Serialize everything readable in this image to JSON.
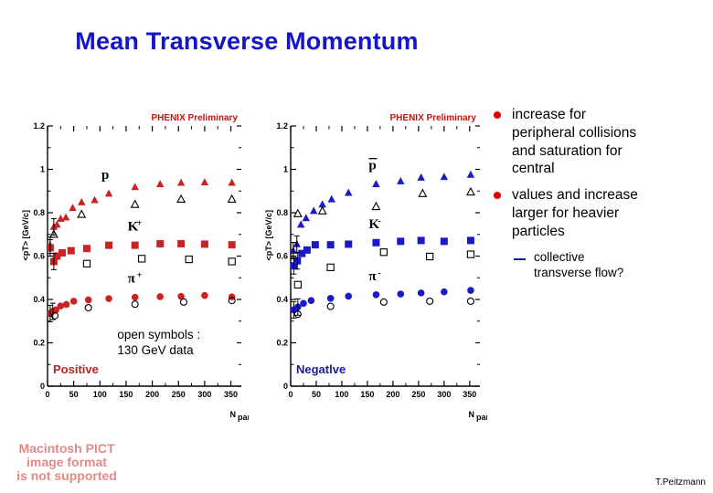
{
  "slide": {
    "title": "Mean Transverse Momentum",
    "footer": "T.Peitzmann"
  },
  "pict_placeholder": {
    "line1": "Macintosh PICT",
    "line2": "image format",
    "line3": "is not supported",
    "color": "#e08a8a"
  },
  "bullets": [
    {
      "text": "increase for peripheral collisions and saturation for central",
      "marker_color": "#e00000"
    },
    {
      "text": "values and increase larger for heavier particles",
      "marker_color": "#e00000"
    }
  ],
  "sub_bullets": [
    {
      "text": "collective transverse flow?",
      "marker_color": "#1a1aa0"
    }
  ],
  "chart_data": [
    {
      "id": "positive",
      "type": "scatter",
      "title": "",
      "preliminary_tag": "PHENIX Preliminary",
      "preliminary_color": "#cc1111",
      "charge_label": "Positive",
      "charge_label_color": "#b32424",
      "annotation_lines": [
        "open symbols :",
        "130 GeV data"
      ],
      "color": "#cc2222",
      "xlabel": "N",
      "xlabel_sub": "part",
      "ylabel": "<p",
      "ylabel_sub": "T",
      "ylabel_unit": "> [GeV/c]",
      "xlim": [
        0,
        370
      ],
      "ylim": [
        0,
        1.2
      ],
      "xticks": [
        0,
        50,
        100,
        150,
        200,
        250,
        300,
        350
      ],
      "yticks": [
        0,
        0.2,
        0.4,
        0.6,
        0.8,
        1,
        1.2
      ],
      "grid": false,
      "series": [
        {
          "name": "p",
          "label": "p",
          "label_sup": "",
          "marker": "triangle",
          "filled": true,
          "x": [
            5,
            12,
            18,
            25,
            35,
            48,
            65,
            90,
            117,
            167,
            215,
            255,
            300,
            352
          ],
          "y": [
            0.65,
            0.735,
            0.745,
            0.772,
            0.778,
            0.822,
            0.848,
            0.858,
            0.888,
            0.918,
            0.932,
            0.938,
            0.94,
            0.938
          ]
        },
        {
          "name": "p-130",
          "label": "",
          "marker": "triangle",
          "filled": false,
          "x": [
            12,
            65,
            167,
            255,
            352
          ],
          "y": [
            0.7,
            0.792,
            0.838,
            0.862,
            0.862
          ]
        },
        {
          "name": "K+",
          "label": "K",
          "label_sup": "+",
          "marker": "square",
          "filled": true,
          "x": [
            5,
            12,
            18,
            28,
            45,
            75,
            117,
            167,
            215,
            255,
            300,
            352
          ],
          "y": [
            0.638,
            0.575,
            0.6,
            0.615,
            0.625,
            0.635,
            0.65,
            0.65,
            0.657,
            0.657,
            0.655,
            0.652
          ]
        },
        {
          "name": "K+-130",
          "label": "",
          "marker": "square",
          "filled": false,
          "x": [
            75,
            180,
            270,
            352
          ],
          "y": [
            0.565,
            0.588,
            0.585,
            0.575
          ]
        },
        {
          "name": "pi+",
          "label": "π",
          "label_sup": "+",
          "marker": "circle",
          "filled": true,
          "x": [
            5,
            10,
            16,
            25,
            36,
            50,
            78,
            117,
            167,
            215,
            255,
            300,
            352
          ],
          "y": [
            0.335,
            0.345,
            0.352,
            0.37,
            0.377,
            0.392,
            0.398,
            0.404,
            0.41,
            0.413,
            0.414,
            0.418,
            0.412
          ]
        },
        {
          "name": "pi+-130",
          "label": "",
          "marker": "circle",
          "filled": false,
          "x": [
            14,
            78,
            167,
            260,
            352
          ],
          "y": [
            0.325,
            0.362,
            0.378,
            0.388,
            0.395
          ]
        }
      ]
    },
    {
      "id": "negative",
      "type": "scatter",
      "title": "",
      "preliminary_tag": "PHENIX Preliminary",
      "preliminary_color": "#cc1111",
      "charge_label": "Negatlve",
      "charge_label_color": "#1a1aa0",
      "annotation_lines": [],
      "color": "#1a1ac8",
      "xlabel": "N",
      "xlabel_sub": "part",
      "ylabel": "<p",
      "ylabel_sub": "T",
      "ylabel_unit": "> [GeV/c]",
      "xlim": [
        0,
        370
      ],
      "ylim": [
        0,
        1.2
      ],
      "xticks": [
        0,
        50,
        100,
        150,
        200,
        250,
        300,
        350
      ],
      "yticks": [
        0,
        0.2,
        0.4,
        0.6,
        0.8,
        1,
        1.2
      ],
      "grid": false,
      "series": [
        {
          "name": "pbar",
          "label": "p",
          "label_bar": true,
          "marker": "triangle",
          "filled": true,
          "x": [
            5,
            12,
            20,
            30,
            45,
            62,
            80,
            113,
            167,
            215,
            255,
            300,
            352
          ],
          "y": [
            0.625,
            0.655,
            0.745,
            0.775,
            0.808,
            0.838,
            0.862,
            0.892,
            0.932,
            0.945,
            0.962,
            0.965,
            0.975
          ]
        },
        {
          "name": "pbar-130",
          "label": "",
          "marker": "triangle",
          "filled": false,
          "x": [
            14,
            62,
            167,
            258,
            352
          ],
          "y": [
            0.795,
            0.808,
            0.828,
            0.888,
            0.895
          ]
        },
        {
          "name": "K-",
          "label": "K",
          "label_sup": "-",
          "marker": "square",
          "filled": true,
          "x": [
            6,
            13,
            22,
            32,
            48,
            78,
            113,
            167,
            215,
            255,
            300,
            352
          ],
          "y": [
            0.555,
            0.578,
            0.612,
            0.628,
            0.652,
            0.652,
            0.655,
            0.662,
            0.668,
            0.672,
            0.668,
            0.672
          ]
        },
        {
          "name": "K--130",
          "label": "",
          "marker": "square",
          "filled": false,
          "x": [
            14,
            78,
            182,
            272,
            352
          ],
          "y": [
            0.468,
            0.548,
            0.618,
            0.598,
            0.608
          ]
        },
        {
          "name": "pi-",
          "label": "π",
          "label_sup": "-",
          "marker": "circle",
          "filled": true,
          "x": [
            6,
            14,
            25,
            40,
            78,
            113,
            167,
            215,
            255,
            300,
            352
          ],
          "y": [
            0.352,
            0.365,
            0.382,
            0.395,
            0.405,
            0.415,
            0.422,
            0.425,
            0.43,
            0.435,
            0.442
          ]
        },
        {
          "name": "pi--130",
          "label": "",
          "marker": "circle",
          "filled": false,
          "x": [
            14,
            78,
            182,
            272,
            352
          ],
          "y": [
            0.332,
            0.368,
            0.388,
            0.392,
            0.392
          ]
        }
      ]
    }
  ]
}
